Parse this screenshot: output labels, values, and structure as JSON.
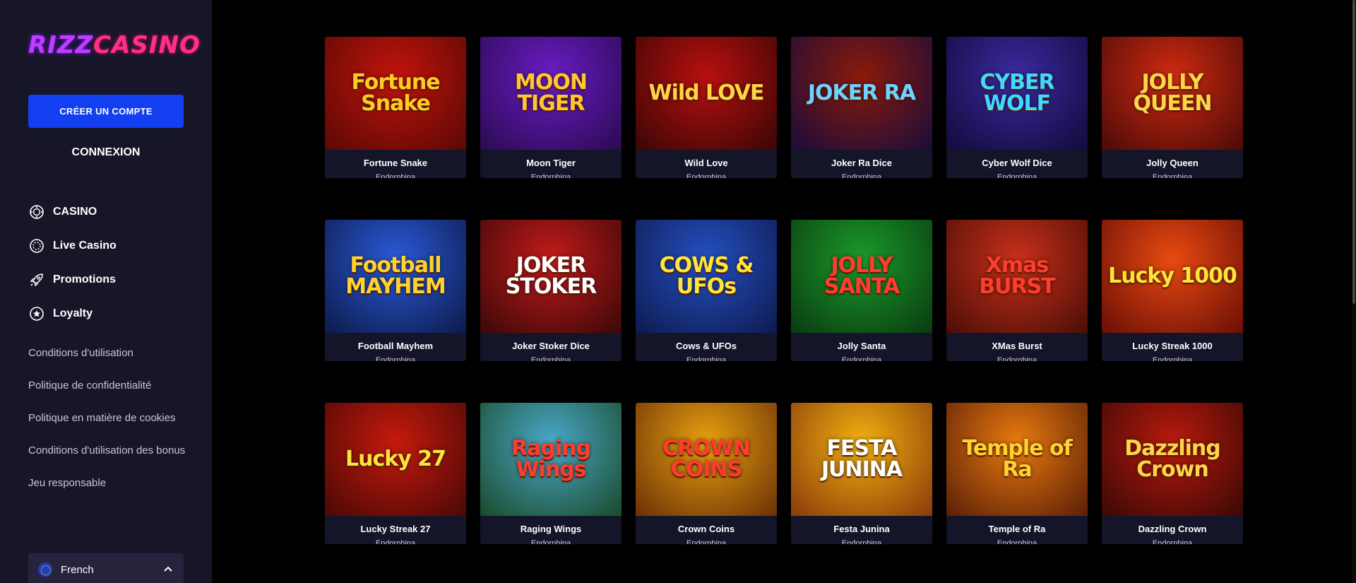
{
  "sidebar": {
    "logo": {
      "part1": "RIZZ",
      "part2": "CASINO"
    },
    "create_account_label": "CRÉER UN COMPTE",
    "login_label": "CONNEXION",
    "nav": [
      {
        "label": "CASINO",
        "icon": "casino-chip-icon"
      },
      {
        "label": "Live Casino",
        "icon": "live-chip-icon"
      },
      {
        "label": "Promotions",
        "icon": "rocket-icon"
      },
      {
        "label": "Loyalty",
        "icon": "star-icon"
      }
    ],
    "links": [
      "Conditions d'utilisation",
      "Politique de confidentialité",
      "Politique en matière de cookies",
      "Conditions d'utilisation des bonus",
      "Jeu responsable"
    ],
    "language": {
      "label": "French",
      "flag": "eu-flag-icon"
    }
  },
  "games": [
    {
      "name": "Fortune Snake",
      "provider": "Endorphina",
      "thumb_text": "Fortune Snake",
      "bg": [
        "#c0140c",
        "#5a0804"
      ],
      "fg": "#ffcc22"
    },
    {
      "name": "Moon Tiger",
      "provider": "Endorphina",
      "thumb_text": "MOON TIGER",
      "bg": [
        "#6a1cc4",
        "#2a0a50"
      ],
      "fg": "#ffc630"
    },
    {
      "name": "Wild Love",
      "provider": "Endorphina",
      "thumb_text": "Wild LOVE",
      "bg": [
        "#b8100e",
        "#3a0606"
      ],
      "fg": "#ffd447"
    },
    {
      "name": "Joker Ra Dice",
      "provider": "Endorphina",
      "thumb_text": "JOKER RA",
      "bg": [
        "#8a1a0a",
        "#1a0c3a"
      ],
      "fg": "#6fd2ff"
    },
    {
      "name": "Cyber Wolf Dice",
      "provider": "Endorphina",
      "thumb_text": "CYBER WOLF",
      "bg": [
        "#3a2aa0",
        "#120a3a"
      ],
      "fg": "#41d9ff"
    },
    {
      "name": "Jolly Queen",
      "provider": "Endorphina",
      "thumb_text": "JOLLY QUEEN",
      "bg": [
        "#d02a10",
        "#4a0a08"
      ],
      "fg": "#ffd447"
    },
    {
      "name": "Football Mayhem",
      "provider": "Endorphina",
      "thumb_text": "Football MAYHEM",
      "bg": [
        "#2a5ad8",
        "#0c1a4a"
      ],
      "fg": "#ffd22e"
    },
    {
      "name": "Joker Stoker Dice",
      "provider": "Endorphina",
      "thumb_text": "JOKER STOKER",
      "bg": [
        "#c41a1a",
        "#3a0808"
      ],
      "fg": "#ffffff"
    },
    {
      "name": "Cows & UFOs",
      "provider": "Endorphina",
      "thumb_text": "COWS & UFOs",
      "bg": [
        "#2450c0",
        "#0e1a50"
      ],
      "fg": "#ffe43a"
    },
    {
      "name": "Jolly Santa",
      "provider": "Endorphina",
      "thumb_text": "JOLLY SANTA",
      "bg": [
        "#1a9a2a",
        "#0a3a10"
      ],
      "fg": "#ff3d2e"
    },
    {
      "name": "XMas Burst",
      "provider": "Endorphina",
      "thumb_text": "Xmas BURST",
      "bg": [
        "#c8301a",
        "#4a0e06"
      ],
      "fg": "#ff3d2e"
    },
    {
      "name": "Lucky Streak 1000",
      "provider": "Endorphina",
      "thumb_text": "Lucky 1000",
      "bg": [
        "#e84a10",
        "#6a0e06"
      ],
      "fg": "#ffe43a"
    },
    {
      "name": "Lucky Streak 27",
      "provider": "Endorphina",
      "thumb_text": "Lucky 27",
      "bg": [
        "#c41a0c",
        "#4a0806"
      ],
      "fg": "#ffe43a"
    },
    {
      "name": "Raging Wings",
      "provider": "Endorphina",
      "thumb_text": "Raging Wings",
      "bg": [
        "#4aa8c8",
        "#1a4a2a"
      ],
      "fg": "#ff3d2e"
    },
    {
      "name": "Crown Coins",
      "provider": "Endorphina",
      "thumb_text": "CROWN COINS",
      "bg": [
        "#e8a010",
        "#6a3006"
      ],
      "fg": "#ff3d2e"
    },
    {
      "name": "Festa Junina",
      "provider": "Endorphina",
      "thumb_text": "FESTA JUNINA",
      "bg": [
        "#f0b010",
        "#8a3a0a"
      ],
      "fg": "#ffffff"
    },
    {
      "name": "Temple of Ra",
      "provider": "Endorphina",
      "thumb_text": "Temple of Ra",
      "bg": [
        "#e87a10",
        "#5a1e06"
      ],
      "fg": "#ffd22e"
    },
    {
      "name": "Dazzling Crown",
      "provider": "Endorphina",
      "thumb_text": "Dazzling Crown",
      "bg": [
        "#b81a0c",
        "#3a0806"
      ],
      "fg": "#ffd447"
    }
  ],
  "colors": {
    "sidebar_bg": "#171628",
    "page_bg": "#000000",
    "accent_blue": "#1240f0",
    "card_bg": "#15152a"
  }
}
